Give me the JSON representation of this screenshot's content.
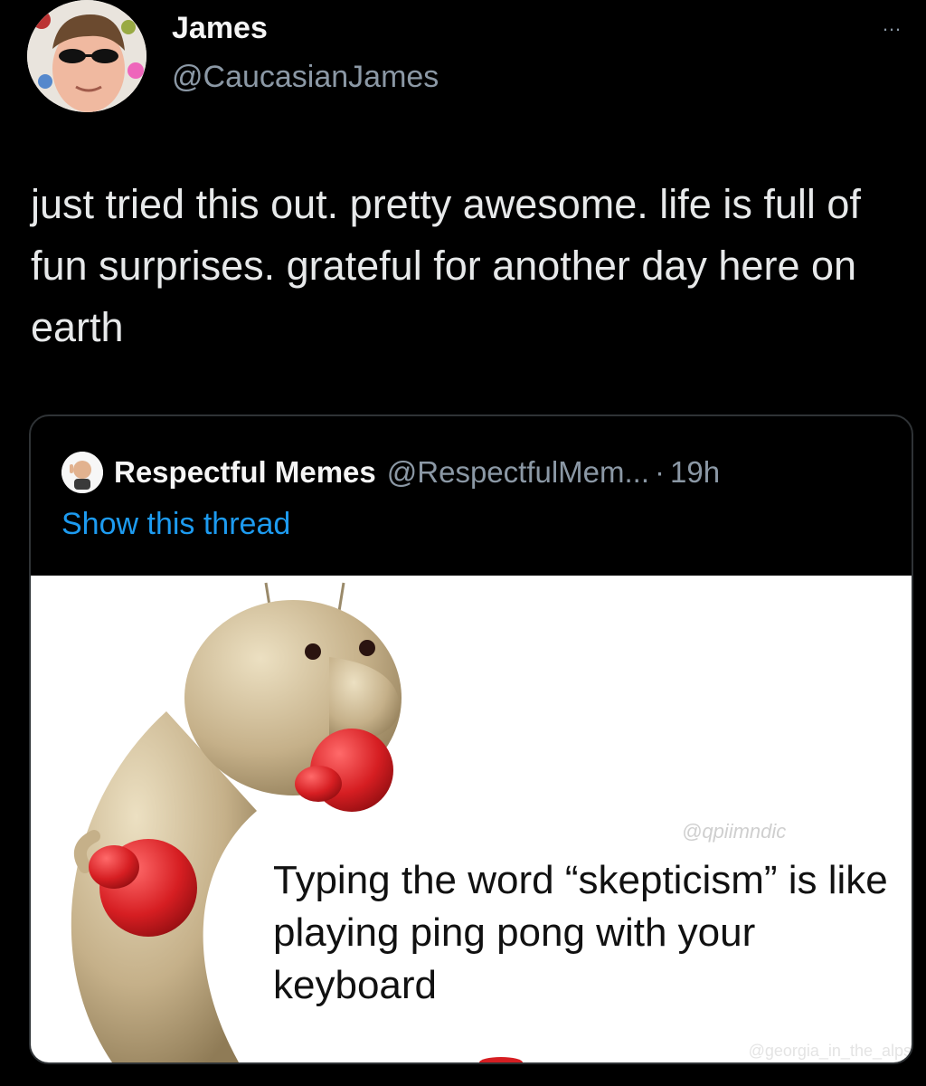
{
  "tweet": {
    "display_name": "James",
    "handle": "@CaucasianJames",
    "more_icon": "…",
    "text": "just tried this out. pretty awesome. life is full of fun surprises. grateful for another day here on earth"
  },
  "quoted_tweet": {
    "display_name": "Respectful Memes",
    "handle": "@RespectfulMem...",
    "separator": "·",
    "time": "19h",
    "show_thread_label": "Show this thread",
    "media": {
      "caption": "Typing the word “skepticism” is like playing ping pong with your keyboard",
      "watermark_top": "@qpiimndic",
      "watermark_bottom": "@georgia_in_the_alps"
    }
  },
  "colors": {
    "background": "#000000",
    "text": "#e7e9ea",
    "secondary": "#8b98a5",
    "link": "#1d9bf0",
    "border": "#2f3336",
    "worm": "#c8b58f",
    "gloves": "#d61e22"
  }
}
